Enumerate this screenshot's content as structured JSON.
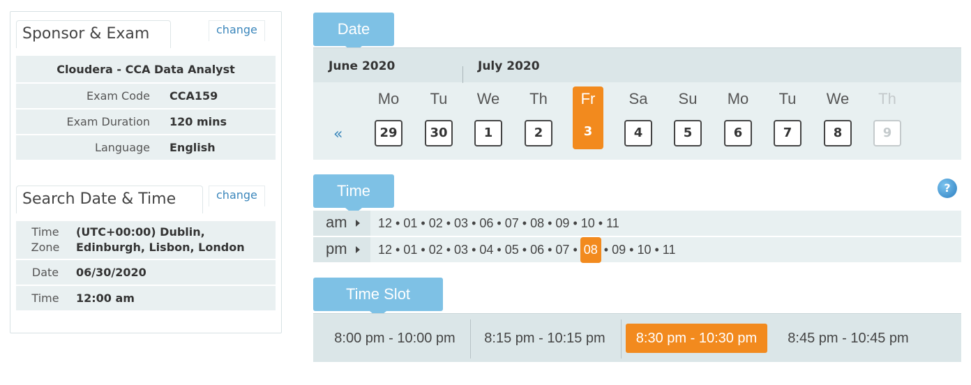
{
  "left": {
    "sponsor_title": "Sponsor & Exam",
    "change_label": "change",
    "exam_name": "Cloudera - CCA Data Analyst",
    "exam_rows": [
      {
        "label": "Exam Code",
        "value": "CCA159"
      },
      {
        "label": "Exam Duration",
        "value": "120 mins"
      },
      {
        "label": "Language",
        "value": "English"
      }
    ],
    "search_title": "Search Date & Time",
    "tz_label_1": "Time",
    "tz_label_2": "Zone",
    "tz_value_1": "(UTC+00:00) Dublin,",
    "tz_value_2": "Edinburgh, Lisbon, London",
    "date_label": "Date",
    "date_value": "06/30/2020",
    "time_label": "Time",
    "time_value": "12:00 am"
  },
  "date_section": {
    "title": "Date",
    "months": [
      "June 2020",
      "July 2020"
    ],
    "prev": "«",
    "days": [
      {
        "name": "Mo",
        "num": "29",
        "state": "normal"
      },
      {
        "name": "Tu",
        "num": "30",
        "state": "normal"
      },
      {
        "name": "We",
        "num": "1",
        "state": "normal"
      },
      {
        "name": "Th",
        "num": "2",
        "state": "normal"
      },
      {
        "name": "Fr",
        "num": "3",
        "state": "selected"
      },
      {
        "name": "Sa",
        "num": "4",
        "state": "normal"
      },
      {
        "name": "Su",
        "num": "5",
        "state": "normal"
      },
      {
        "name": "Mo",
        "num": "6",
        "state": "normal"
      },
      {
        "name": "Tu",
        "num": "7",
        "state": "normal"
      },
      {
        "name": "We",
        "num": "8",
        "state": "normal"
      },
      {
        "name": "Th",
        "num": "9",
        "state": "disabled"
      }
    ]
  },
  "time_section": {
    "title": "Time",
    "help": "?",
    "separator": "•",
    "rows": [
      {
        "label": "am",
        "hours": [
          "12",
          "01",
          "02",
          "03",
          "06",
          "07",
          "08",
          "09",
          "10",
          "11"
        ],
        "selected": ""
      },
      {
        "label": "pm",
        "hours": [
          "12",
          "01",
          "02",
          "03",
          "04",
          "05",
          "06",
          "07",
          "08",
          "09",
          "10",
          "11"
        ],
        "selected": "08"
      }
    ]
  },
  "slot_section": {
    "title": "Time Slot",
    "slots": [
      {
        "label": "8:00 pm - 10:00 pm",
        "selected": false
      },
      {
        "label": "8:15 pm - 10:15 pm",
        "selected": false
      },
      {
        "label": "8:30 pm - 10:30 pm",
        "selected": true
      },
      {
        "label": "8:45 pm - 10:45 pm",
        "selected": false
      }
    ]
  },
  "colors": {
    "accent": "#f28a1e",
    "header_blue": "#7ec1e5",
    "link": "#3a86bb",
    "panel_bg": "#e8f0f1"
  }
}
